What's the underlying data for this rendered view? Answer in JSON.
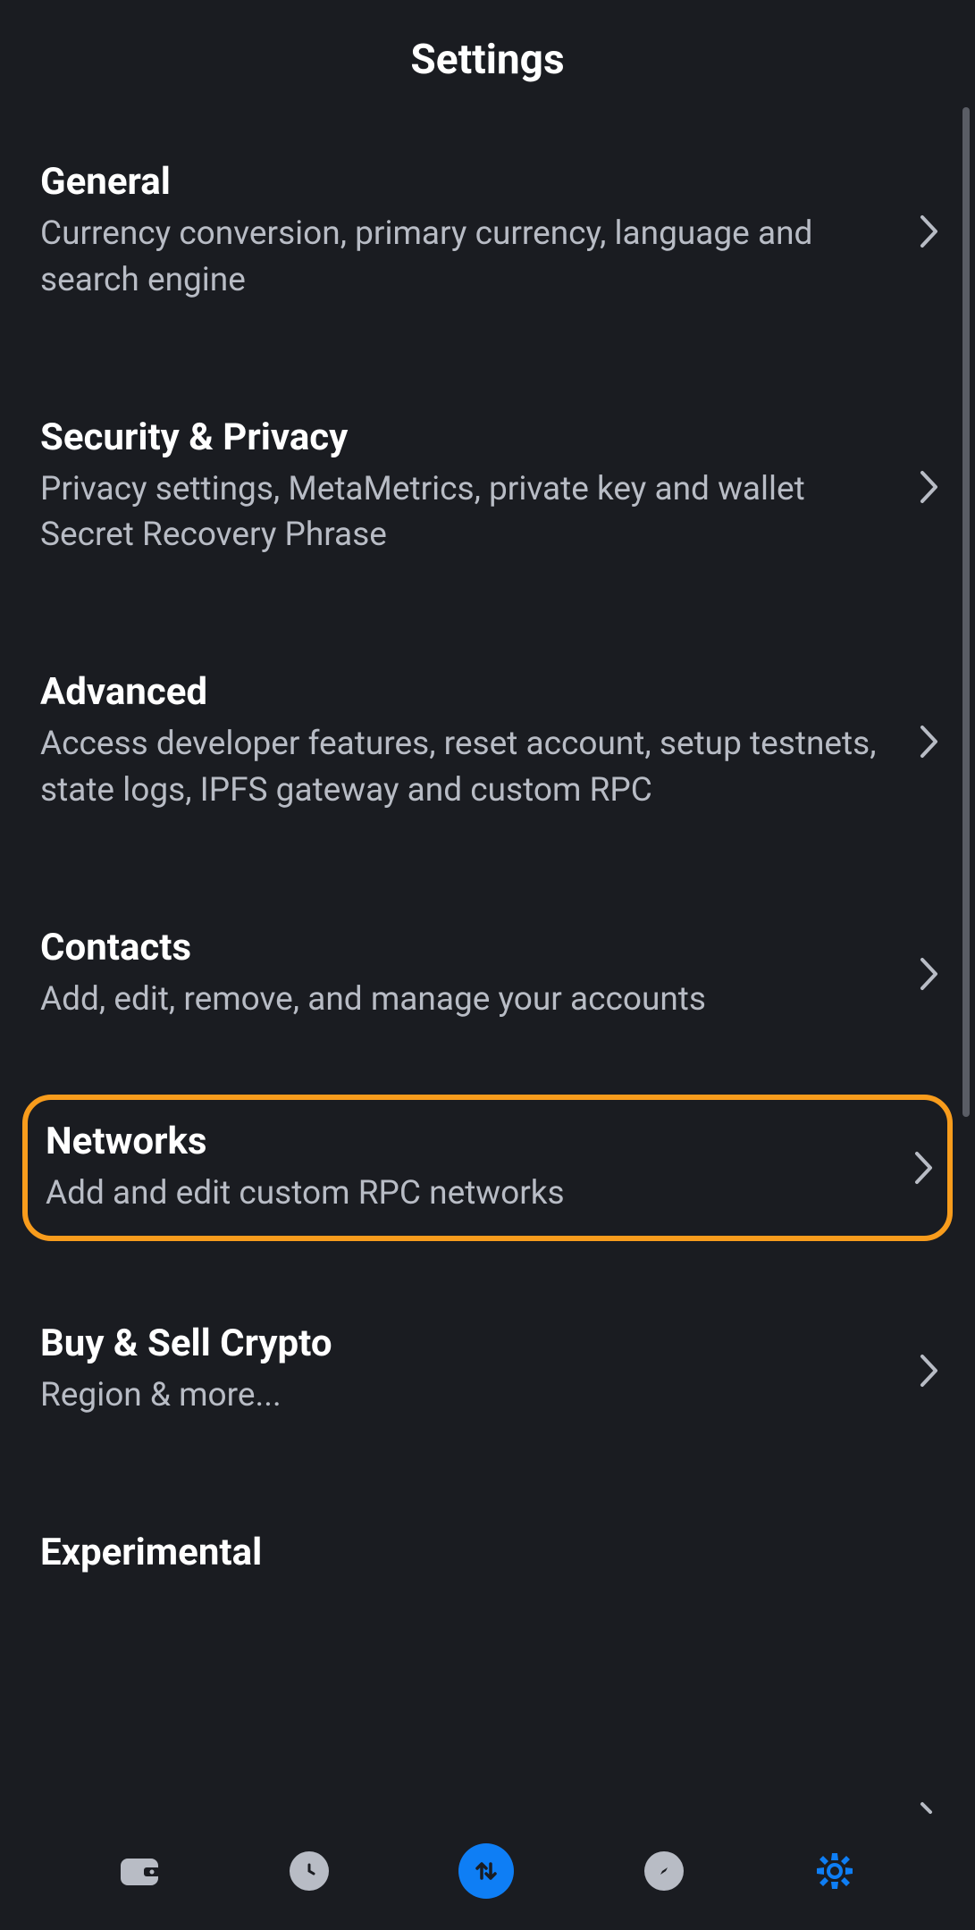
{
  "header": {
    "title": "Settings"
  },
  "settings": [
    {
      "id": "general",
      "title": "General",
      "description": "Currency conversion, primary currency, language and search engine",
      "highlighted": false
    },
    {
      "id": "security",
      "title": "Security & Privacy",
      "description": "Privacy settings, MetaMetrics, private key and wallet Secret Recovery Phrase",
      "highlighted": false
    },
    {
      "id": "advanced",
      "title": "Advanced",
      "description": "Access developer features, reset account, setup testnets, state logs, IPFS gateway and custom RPC",
      "highlighted": false
    },
    {
      "id": "contacts",
      "title": "Contacts",
      "description": "Add, edit, remove, and manage your accounts",
      "highlighted": false
    },
    {
      "id": "networks",
      "title": "Networks",
      "description": "Add and edit custom RPC networks",
      "highlighted": true
    },
    {
      "id": "buysell",
      "title": "Buy & Sell Crypto",
      "description": "Region & more...",
      "highlighted": false
    },
    {
      "id": "experimental",
      "title": "Experimental",
      "description": "",
      "highlighted": false
    }
  ],
  "nav": {
    "items": [
      "wallet",
      "history",
      "swap",
      "browser",
      "settings"
    ],
    "active": "settings",
    "center": "swap"
  }
}
